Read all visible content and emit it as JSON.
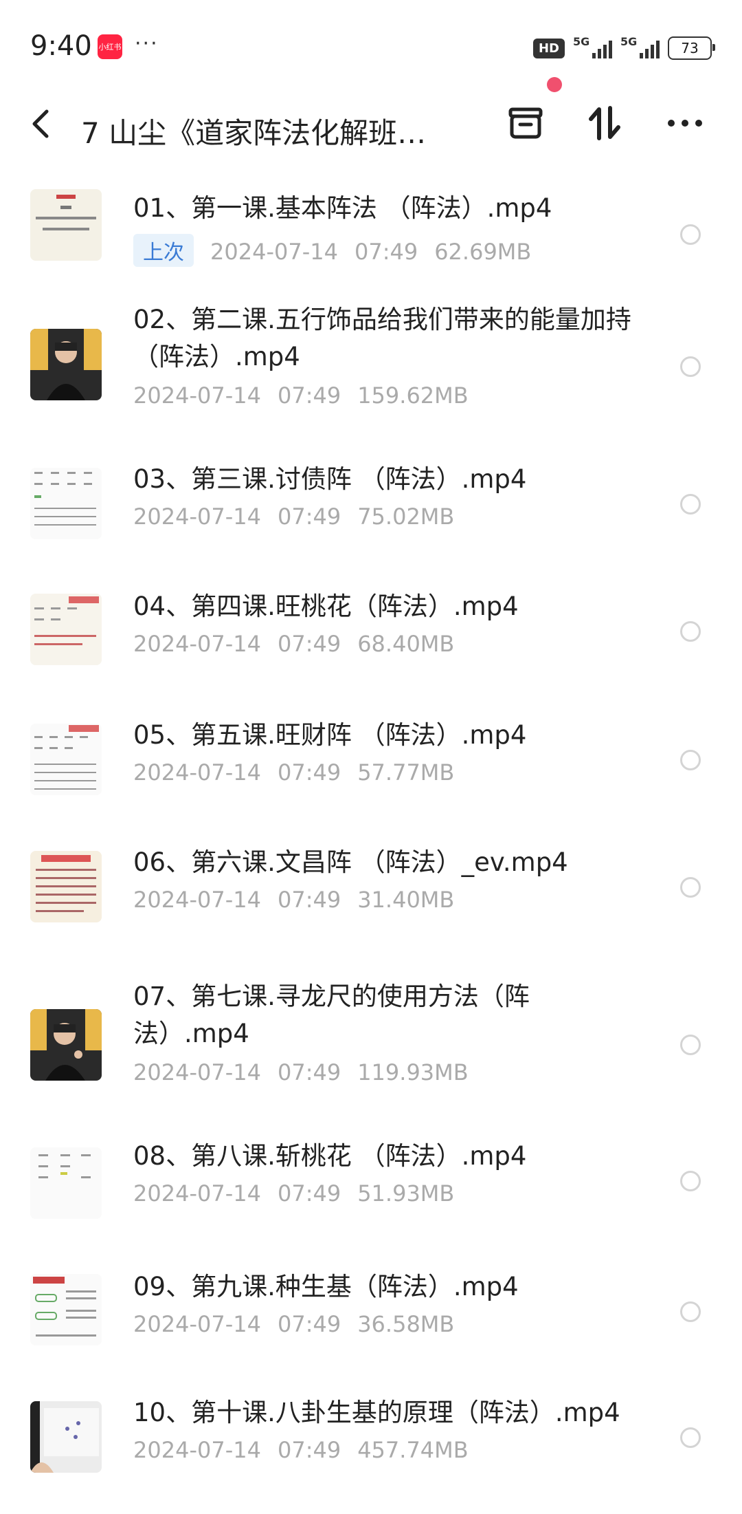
{
  "status_bar": {
    "time": "9:40",
    "app_badge": "小红书",
    "more": "···",
    "hd": "HD",
    "signal1": "5G",
    "signal2": "5G",
    "battery": "73"
  },
  "header": {
    "back_icon": "chevron-left",
    "title": "7 山尘《道家阵法化解班…",
    "icons": [
      "archive-icon",
      "sort-icon",
      "more-icon"
    ],
    "notification_color": "#f0506e"
  },
  "items": [
    {
      "name": "01、第一课.基本阵法 （阵法）.mp4",
      "last_tag": "上次",
      "date": "2024-07-14",
      "time": "07:49",
      "size": "62.69MB",
      "thumb": "doc"
    },
    {
      "name": "02、第二课.五行饰品给我们带来的能量加持（阵法）.mp4",
      "date": "2024-07-14",
      "time": "07:49",
      "size": "159.62MB",
      "thumb": "person"
    },
    {
      "name": "03、第三课.讨债阵 （阵法）.mp4",
      "date": "2024-07-14",
      "time": "07:49",
      "size": "75.02MB",
      "thumb": "table"
    },
    {
      "name": "04、第四课.旺桃花（阵法）.mp4",
      "date": "2024-07-14",
      "time": "07:49",
      "size": "68.40MB",
      "thumb": "table-red"
    },
    {
      "name": "05、第五课.旺财阵 （阵法）.mp4",
      "date": "2024-07-14",
      "time": "07:49",
      "size": "57.77MB",
      "thumb": "table-red"
    },
    {
      "name": "06、第六课.文昌阵 （阵法）_ev.mp4",
      "date": "2024-07-14",
      "time": "07:49",
      "size": "31.40MB",
      "thumb": "doc-red"
    },
    {
      "name": "07、第七课.寻龙尺的使用方法（阵法）.mp4",
      "date": "2024-07-14",
      "time": "07:49",
      "size": "119.93MB",
      "thumb": "person"
    },
    {
      "name": "08、第八课.斩桃花 （阵法）.mp4",
      "date": "2024-07-14",
      "time": "07:49",
      "size": "51.93MB",
      "thumb": "table"
    },
    {
      "name": "09、第九课.种生基（阵法）.mp4",
      "date": "2024-07-14",
      "time": "07:49",
      "size": "36.58MB",
      "thumb": "mindmap"
    },
    {
      "name": "10、第十课.八卦生基的原理（阵法）.mp4",
      "date": "2024-07-14",
      "time": "07:49",
      "size": "457.74MB",
      "thumb": "board"
    }
  ]
}
